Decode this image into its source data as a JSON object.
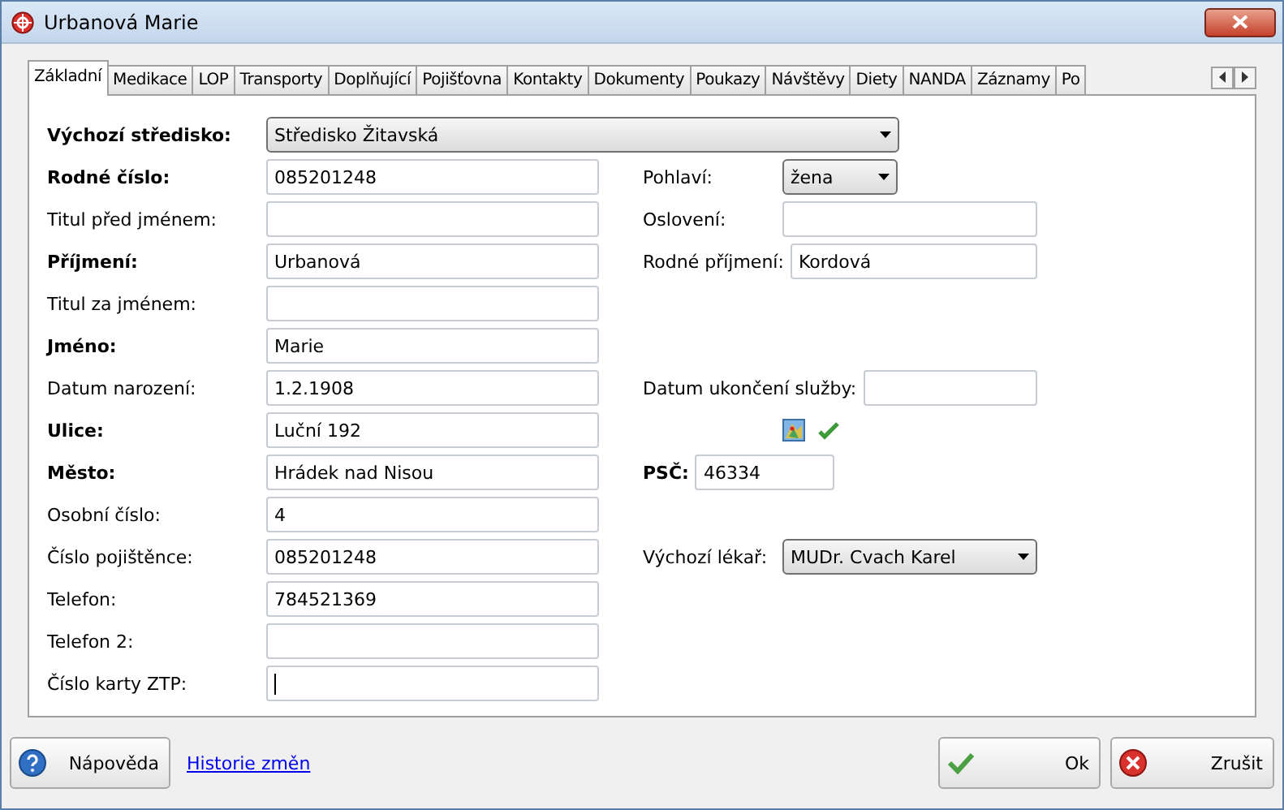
{
  "window": {
    "title": "Urbanová Marie"
  },
  "tabs": [
    {
      "label": "Základní",
      "selected": true
    },
    {
      "label": "Medikace",
      "selected": false
    },
    {
      "label": "LOP",
      "selected": false
    },
    {
      "label": "Transporty",
      "selected": false
    },
    {
      "label": "Doplňující",
      "selected": false
    },
    {
      "label": "Pojišťovna",
      "selected": false
    },
    {
      "label": "Kontakty",
      "selected": false
    },
    {
      "label": "Dokumenty",
      "selected": false
    },
    {
      "label": "Poukazy",
      "selected": false
    },
    {
      "label": "Návštěvy",
      "selected": false
    },
    {
      "label": "Diety",
      "selected": false
    },
    {
      "label": "NANDA",
      "selected": false
    },
    {
      "label": "Záznamy",
      "selected": false
    },
    {
      "label": "Po",
      "selected": false
    }
  ],
  "rows": [
    {
      "left": {
        "label": "Výchozí středisko:",
        "bold": true,
        "kind": "select",
        "value": "Středisko Žitavská"
      }
    },
    {
      "left": {
        "label": "Rodné číslo:",
        "bold": true,
        "kind": "field",
        "value": "085201248"
      },
      "right": {
        "label": "Pohlaví:",
        "bold": false,
        "kind": "select",
        "value": "žena"
      }
    },
    {
      "left": {
        "label": "Titul před jménem:",
        "bold": false,
        "kind": "field"
      },
      "right": {
        "label": "Oslovení:",
        "bold": false,
        "kind": "field"
      }
    },
    {
      "left": {
        "label": "Příjmení:",
        "bold": true,
        "kind": "field",
        "value": "Urbanová"
      },
      "right": {
        "label": "Rodné příjmení:",
        "bold": false,
        "kind": "field",
        "value": "Kordová"
      }
    },
    {
      "left": {
        "label": "Titul za jménem:",
        "bold": false,
        "kind": "field"
      }
    },
    {
      "left": {
        "label": "Jméno:",
        "bold": true,
        "kind": "field",
        "value": "Marie"
      }
    },
    {
      "left": {
        "label": "Datum narození:",
        "bold": false,
        "kind": "field",
        "value": "1.2.1908"
      },
      "right": {
        "label": "Datum ukončení služby:",
        "bold": false,
        "kind": "field"
      }
    },
    {
      "left": {
        "label": "Ulice:",
        "bold": true,
        "kind": "field",
        "value": "Luční 192"
      },
      "right": {
        "kind": "icons"
      }
    },
    {
      "left": {
        "label": "Město:",
        "bold": true,
        "kind": "field",
        "value": "Hrádek nad Nisou"
      },
      "right": {
        "label": "PSČ:",
        "bold": true,
        "kind": "field",
        "value": "46334"
      }
    },
    {
      "left": {
        "label": "Osobní číslo:",
        "bold": false,
        "kind": "field",
        "value": "4"
      }
    },
    {
      "left": {
        "label": "Číslo pojištěnce:",
        "bold": false,
        "kind": "field",
        "value": "085201248"
      },
      "right": {
        "label": "Výchozí lékař:",
        "bold": false,
        "kind": "select",
        "value": "MUDr. Cvach Karel"
      }
    },
    {
      "left": {
        "label": "Telefon:",
        "bold": false,
        "kind": "field",
        "value": "784521369"
      }
    },
    {
      "left": {
        "label": "Telefon 2:",
        "bold": false,
        "kind": "field"
      }
    },
    {
      "left": {
        "label": "Číslo karty ZTP:",
        "bold": false,
        "kind": "field",
        "focused": true
      }
    }
  ],
  "footer": {
    "help_button": "Nápověda",
    "history_link": "Historie změn",
    "ok_button": "Ok",
    "cancel_button": "Zrušit"
  }
}
